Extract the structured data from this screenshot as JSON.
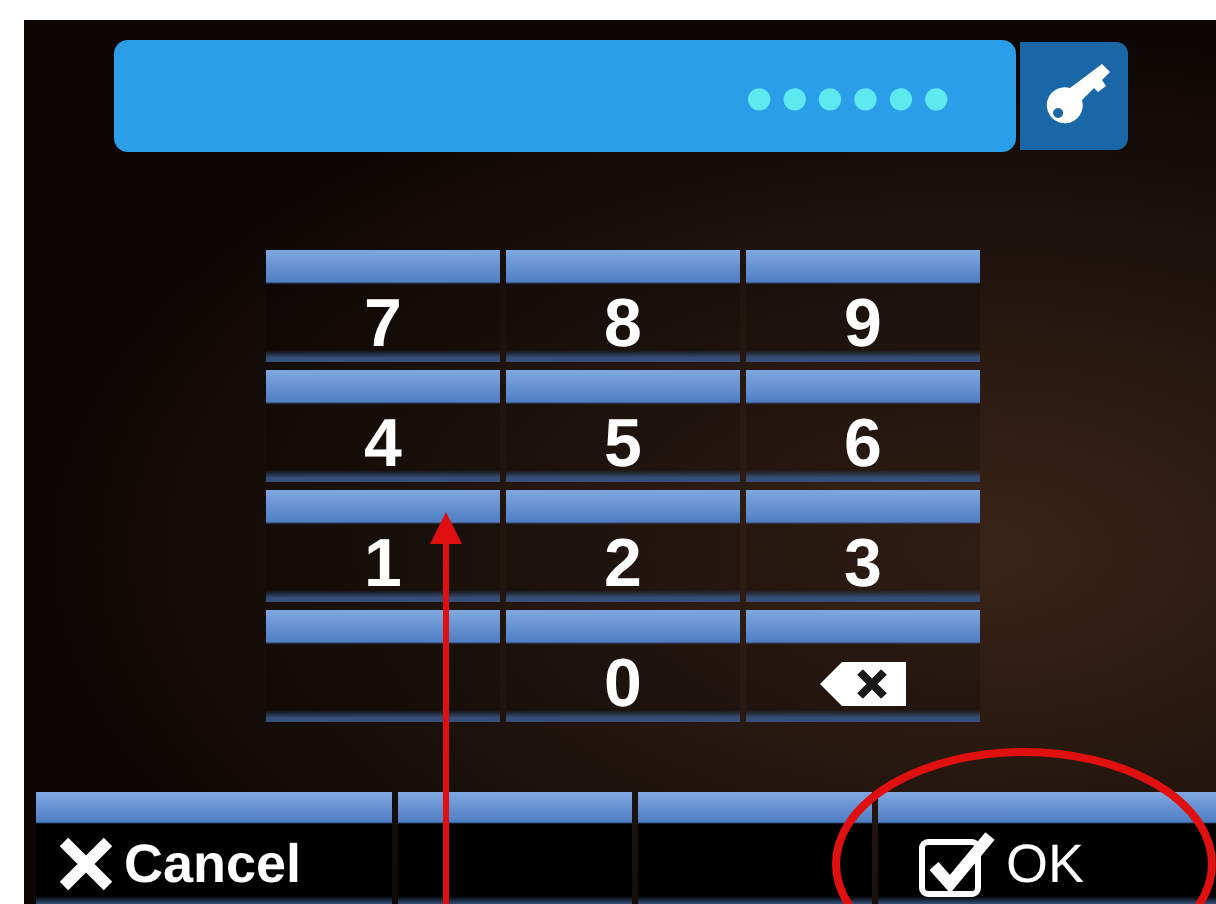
{
  "pin_field": {
    "value": "●●●●●●"
  },
  "keypad": [
    {
      "kind": "digit",
      "label": "7"
    },
    {
      "kind": "digit",
      "label": "8"
    },
    {
      "kind": "digit",
      "label": "9"
    },
    {
      "kind": "digit",
      "label": "4"
    },
    {
      "kind": "digit",
      "label": "5"
    },
    {
      "kind": "digit",
      "label": "6"
    },
    {
      "kind": "digit",
      "label": "1"
    },
    {
      "kind": "digit",
      "label": "2"
    },
    {
      "kind": "digit",
      "label": "3"
    },
    {
      "kind": "blank"
    },
    {
      "kind": "digit",
      "label": "0"
    },
    {
      "kind": "backspace"
    }
  ],
  "bottom_bar": [
    {
      "kind": "cancel",
      "label": "Cancel"
    },
    {
      "kind": "blank"
    },
    {
      "kind": "blank"
    },
    {
      "kind": "ok",
      "label": "OK"
    }
  ],
  "annotations": [
    {
      "kind": "arrow"
    },
    {
      "kind": "ellipse"
    }
  ]
}
